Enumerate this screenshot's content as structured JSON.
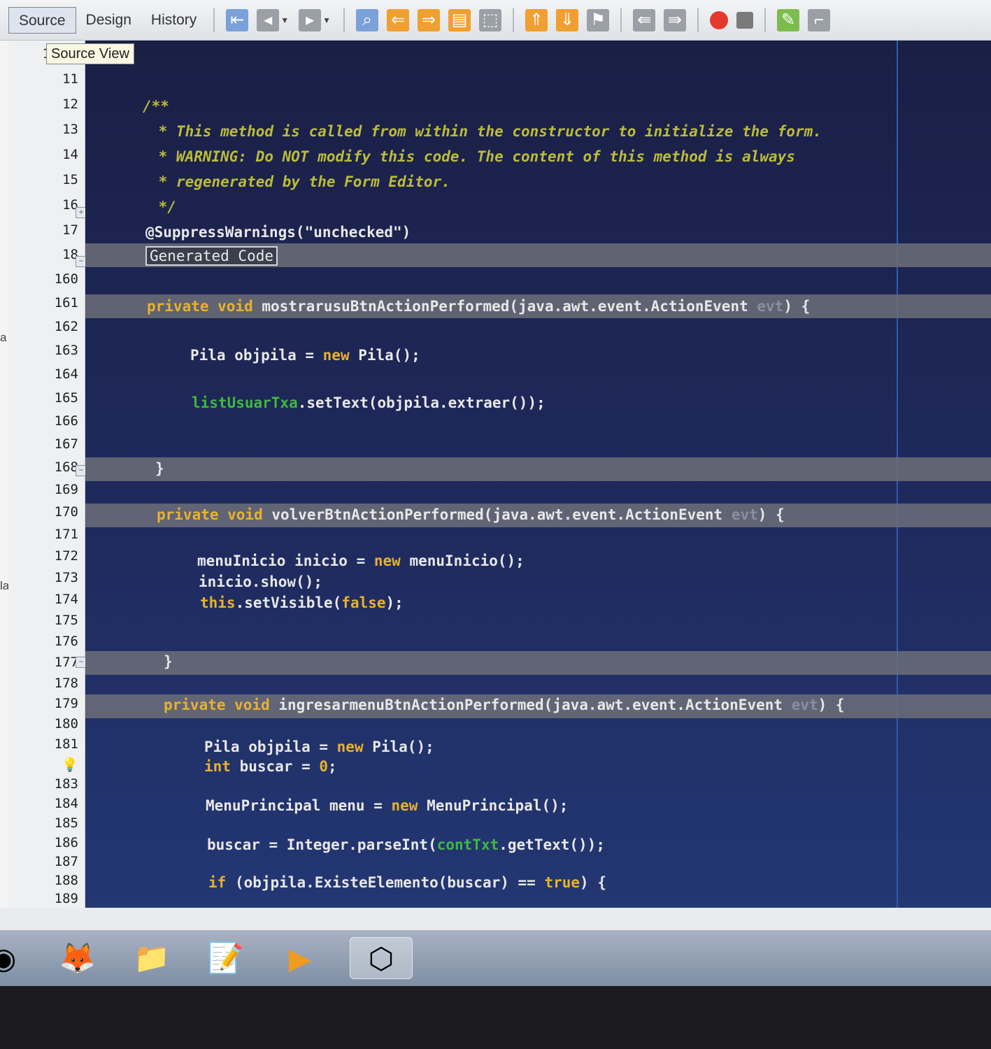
{
  "toolbar": {
    "tabs": [
      {
        "label": "Source",
        "active": true
      },
      {
        "label": "Design",
        "active": false
      },
      {
        "label": "History",
        "active": false
      }
    ],
    "icons": [
      "go-to-source-icon",
      "back-icon",
      "forward-icon",
      "find-icon",
      "prev-occurrence-icon",
      "next-occurrence-icon",
      "toggle-highlight-icon",
      "toggle-rect-select-icon",
      "prev-bookmark-icon",
      "next-bookmark-icon",
      "toggle-bookmark-icon",
      "shift-left-icon",
      "shift-right-icon",
      "start-macro-icon",
      "stop-macro-icon",
      "comment-icon",
      "uncomment-icon"
    ]
  },
  "tooltip": "Source View",
  "side_labels": [
    "a",
    "lar"
  ],
  "line_numbers": [
    "1",
    "11",
    "12",
    "13",
    "14",
    "15",
    "16",
    "17",
    "18",
    "160",
    "161",
    "162",
    "163",
    "164",
    "165",
    "166",
    "167",
    "168",
    "169",
    "170",
    "171",
    "172",
    "173",
    "174",
    "175",
    "176",
    "177",
    "178",
    "179",
    "180",
    "181",
    "",
    "183",
    "184",
    "185",
    "186",
    "187",
    "188",
    "189"
  ],
  "code": {
    "c1": "/**",
    "c2": " * This method is called from within the constructor to initialize the form.",
    "c3": " * WARNING: Do NOT modify this code. The content of this method is always",
    "c4": " * regenerated by the Form Editor.",
    "c5": " */",
    "annotation": "@SuppressWarnings(\"unchecked\")",
    "generated": "Generated Code",
    "m1_kw": "private void",
    "m1_sig": " mostrarusuBtnActionPerformed(java.awt.event.ActionEvent ",
    "evt": "evt",
    "m1_end": ") {",
    "m1_l1a": "Pila objpila = ",
    "new": "new",
    "m1_l1b": " Pila();",
    "m1_field": "listUsuarTxa",
    "m1_l2": ".setText(objpila.extraer());",
    "close": "}",
    "m2_kw": "private void",
    "m2_sig": " volverBtnActionPerformed(java.awt.event.ActionEvent ",
    "m2_end": ") {",
    "m2_l1a": "menuInicio inicio = ",
    "m2_l1b": " menuInicio();",
    "m2_l2": "inicio.show();",
    "this": "this",
    "m2_l3a": ".setVisible(",
    "false": "false",
    "m2_l3b": ");",
    "m3_kw": "private void",
    "m3_sig": " ingresarmenuBtnActionPerformed(java.awt.event.ActionEvent ",
    "m3_end": ") {",
    "m3_l1a": "Pila objpila = ",
    "m3_l1b": " Pila();",
    "int": "int",
    "m3_l2a": " buscar = ",
    "zero": "0",
    "m3_l2b": ";",
    "m3_l3a": "MenuPrincipal menu = ",
    "m3_l3b": " MenuPrincipal();",
    "m3_l4a": "buscar = Integer.parseInt(",
    "m3_field": "contTxt",
    "m3_l4b": ".getText());",
    "if": "if",
    "m3_l5a": " (objpila.ExisteElemento(buscar) == ",
    "true": "true",
    "m3_l5b": ") {"
  },
  "taskbar": [
    "chrome-icon",
    "firefox-icon",
    "file-explorer-icon",
    "notepad-plus-plus-icon",
    "media-player-icon",
    "netbeans-icon"
  ]
}
